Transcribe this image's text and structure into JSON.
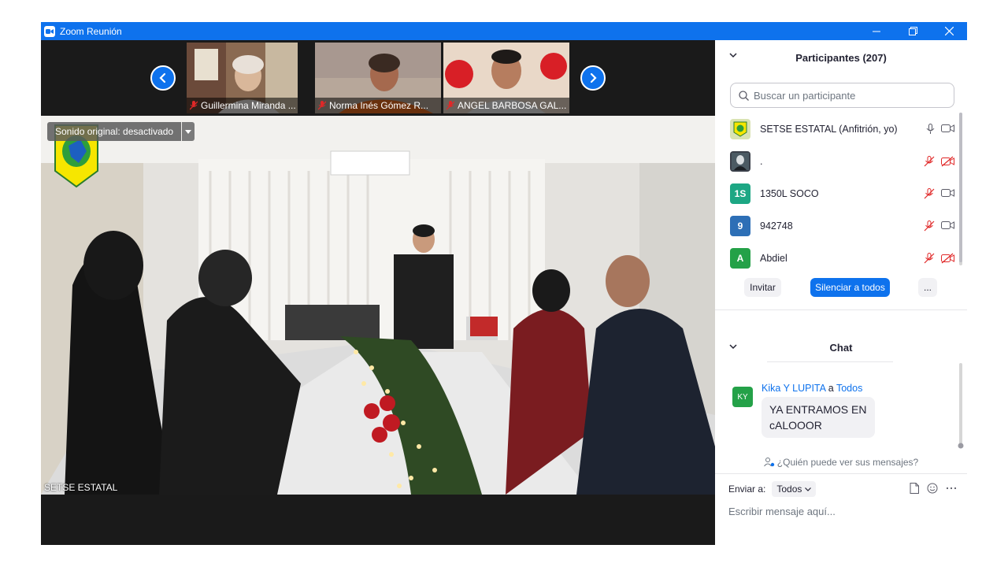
{
  "window": {
    "title": "Zoom Reunión",
    "controls": [
      "minimize",
      "restore",
      "close"
    ]
  },
  "meeting": {
    "thumbnails": [
      {
        "name": "Guillermina Miranda ...",
        "muted": true
      },
      {
        "name": "Norma Inés Gómez R...",
        "muted": true
      },
      {
        "name": "ANGEL BARBOSA GAL...",
        "muted": true
      }
    ],
    "original_sound": "Sonido original: desactivado",
    "main_speaker": "SETSE ESTATAL"
  },
  "participants": {
    "title": "Participantes (207)",
    "search_placeholder": "Buscar un participante",
    "list": [
      {
        "name": "SETSE ESTATAL (Anfitrión, yo)",
        "avatar": "logo",
        "avatar_color": "#d9e3b3",
        "mic": "on",
        "video": "on"
      },
      {
        "name": ".",
        "avatar": "photo",
        "avatar_color": "#3a3f49",
        "mic": "muted",
        "video": "off"
      },
      {
        "name": "1350L SOCO",
        "avatar": "1S",
        "avatar_color": "#1da784",
        "mic": "muted",
        "video": "on"
      },
      {
        "name": "942748",
        "avatar": "9",
        "avatar_color": "#2d6fb6",
        "mic": "muted",
        "video": "on"
      },
      {
        "name": "Abdiel",
        "avatar": "A",
        "avatar_color": "#24a148",
        "mic": "muted",
        "video": "off"
      }
    ],
    "actions": {
      "invite": "Invitar",
      "mute_all": "Silenciar a todos",
      "more": "..."
    }
  },
  "chat": {
    "title": "Chat",
    "messages": [
      {
        "avatar": "KY",
        "sender": "Kika Y LUPITA",
        "connector": "a",
        "recipient": "Todos",
        "text": "YA ENTRAMOS EN cALOOOR"
      }
    ],
    "who_can_see": "¿Quién puede ver sus mensajes?",
    "send_to_label": "Enviar a:",
    "send_to_value": "Todos",
    "input_placeholder": "Escribir mensaje aquí..."
  },
  "colors": {
    "accent": "#0e72ed",
    "muted_red": "#e02828",
    "titlebar": "#0e72ed"
  }
}
